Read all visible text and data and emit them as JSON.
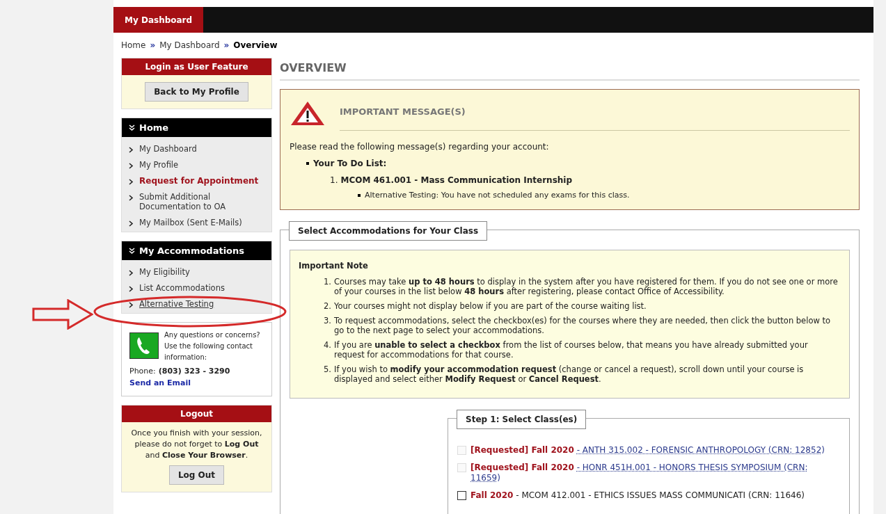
{
  "top_nav": {
    "tabs": [
      {
        "label": "My Dashboard",
        "selected": true
      }
    ]
  },
  "breadcrumb": [
    {
      "label": "Home",
      "current": false
    },
    {
      "label": "My Dashboard",
      "current": false
    },
    {
      "label": "Overview",
      "current": true
    }
  ],
  "breadcrumb_separator": "»",
  "login_panel": {
    "title": "Login as User Feature",
    "button": "Back to My Profile"
  },
  "menus": [
    {
      "title": "Home",
      "items": [
        {
          "label": "My Dashboard",
          "kind": "plain"
        },
        {
          "label": "My Profile",
          "kind": "plain"
        },
        {
          "label": "Request for Appointment",
          "kind": "alert"
        },
        {
          "label": "Submit Additional Documentation to OA",
          "kind": "plain"
        },
        {
          "label": "My Mailbox (Sent E-Mails)",
          "kind": "plain"
        }
      ]
    },
    {
      "title": "My Accommodations",
      "items": [
        {
          "label": "My Eligibility",
          "kind": "plain"
        },
        {
          "label": "List Accommodations",
          "kind": "plain"
        },
        {
          "label": "Alternative Testing",
          "kind": "underlined"
        }
      ]
    }
  ],
  "contact": {
    "text": "Any questions or concerns? Use the following contact information:",
    "phone_label": "Phone:",
    "phone": "(803) 323 - 3290",
    "email_link": "Send an Email"
  },
  "logout_panel": {
    "title": "Logout",
    "message": "Once you finish with your session, please do not forget to **Log Out** and **Close Your Browser**.",
    "button": "Log Out"
  },
  "heading": "OVERVIEW",
  "message_box": {
    "title": "IMPORTANT MESSAGE(S)",
    "intro": "Please read the following message(s) regarding your account:",
    "todo_heading": "Your To Do List:",
    "todo": [
      {
        "number": "1.",
        "course": "MCOM 461.001 - Mass Communication Internship",
        "notes": [
          "Alternative Testing: You have not scheduled any exams for this class."
        ]
      }
    ]
  },
  "accommodations": {
    "legend": "Select Accommodations for Your Class",
    "note_title": "Important Note",
    "notes": [
      {
        "number": "1.",
        "text": "Courses may take **up to 48 hours** to display in the system after you have registered for them. If you do not see one or more of your courses in the list below **48 hours** after registering, please contact Office of Accessibility."
      },
      {
        "number": "2.",
        "text": "Your courses might not display below if you are part of the course waiting list."
      },
      {
        "number": "3.",
        "text": "To request accommodations, select the checkbox(es) for the courses where they are needed, then click the button below to go to the next page to select your accommodations."
      },
      {
        "number": "4.",
        "text": "If you are **unable to select a checkbox** from the list of courses below, that means you have already submitted your request for accommodations for that course."
      },
      {
        "number": "5.",
        "text": "If you wish to **modify your accommodation request** (change or cancel a request), scroll down until your course is displayed and select either **Modify Request** or **Cancel Request**."
      }
    ]
  },
  "step1": {
    "legend": "Step 1: Select Class(es)",
    "classes": [
      {
        "term": "[Requested] Fall 2020",
        "course": "- ANTH 315.002 - FORENSIC ANTHROPOLOGY (CRN: 12852)",
        "disabled": true,
        "checked": false
      },
      {
        "term": "[Requested] Fall 2020",
        "course": "- HONR 451H.001 - HONORS THESIS SYMPOSIUM (CRN: 11659)",
        "disabled": true,
        "checked": false
      },
      {
        "term": "Fall 2020",
        "course": "- MCOM 412.001 - ETHICS ISSUES MASS COMMUNICATI (CRN: 11646)",
        "disabled": false,
        "checked": false
      }
    ]
  }
}
